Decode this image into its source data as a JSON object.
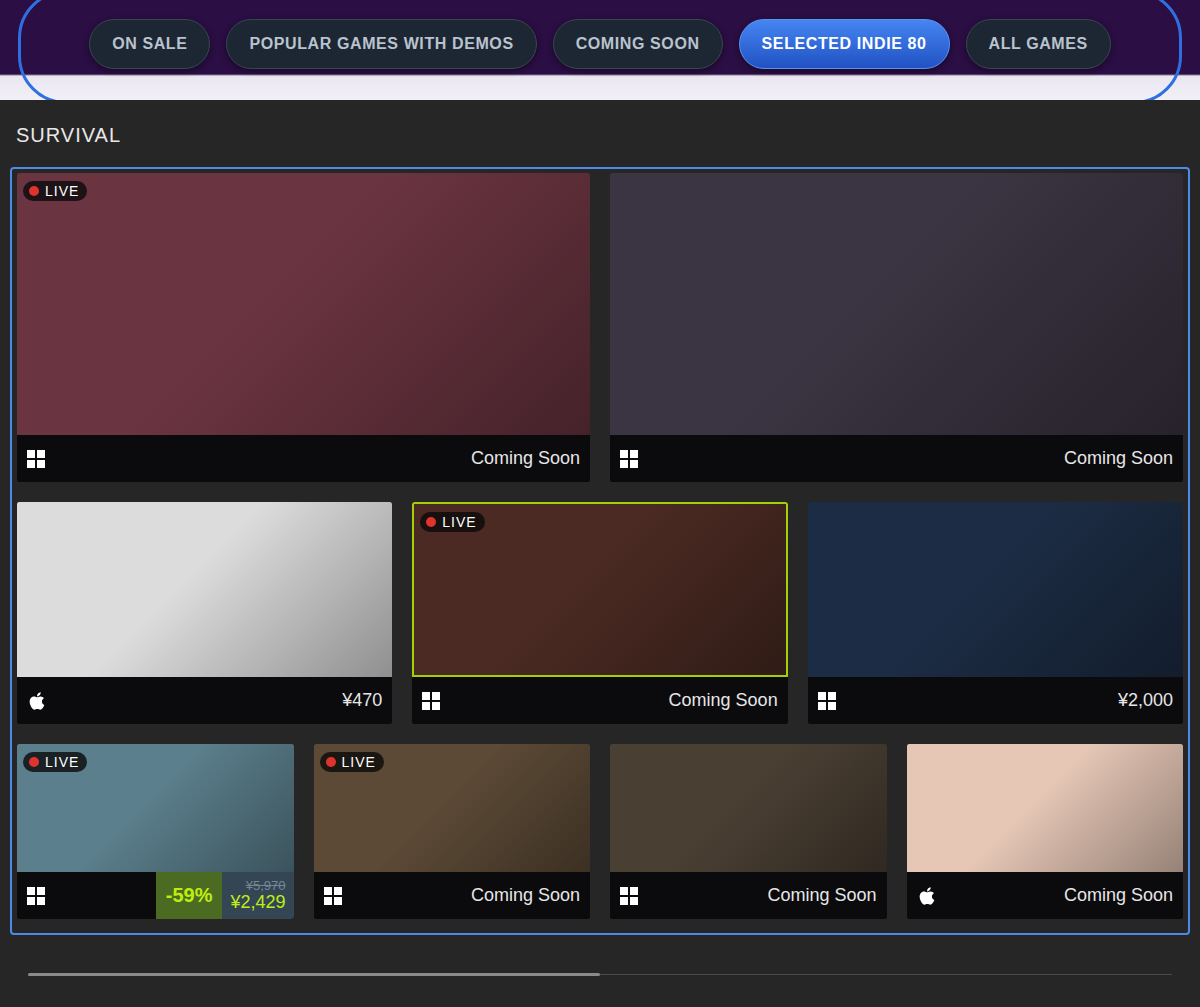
{
  "nav": {
    "tabs": [
      {
        "label": "ON SALE",
        "selected": false
      },
      {
        "label": "POPULAR GAMES WITH DEMOS",
        "selected": false
      },
      {
        "label": "COMING SOON",
        "selected": false
      },
      {
        "label": "SELECTED INDIE 80",
        "selected": true
      },
      {
        "label": "ALL GAMES",
        "selected": false
      }
    ]
  },
  "section": {
    "title": "SURVIVAL"
  },
  "live_badge": "LIVE",
  "rows": [
    {
      "games": [
        {
          "kind": "text",
          "platform": "windows",
          "price": "Coming Soon",
          "live": true,
          "highlighted": false,
          "color": "#6a3440"
        },
        {
          "kind": "text",
          "platform": "windows",
          "price": "Coming Soon",
          "live": false,
          "highlighted": false,
          "color": "#3b3442"
        }
      ]
    },
    {
      "games": [
        {
          "kind": "text",
          "platform": "apple",
          "price": "¥470",
          "live": false,
          "highlighted": false,
          "color": "#dcdcdc"
        },
        {
          "kind": "text",
          "platform": "windows",
          "price": "Coming Soon",
          "live": true,
          "highlighted": true,
          "color": "#4a2a22"
        },
        {
          "kind": "text",
          "platform": "windows",
          "price": "¥2,000",
          "live": false,
          "highlighted": false,
          "color": "#1c2c44"
        }
      ]
    },
    {
      "games": [
        {
          "kind": "discount",
          "platform": "windows",
          "discount": "-59%",
          "original_price": "¥5,970",
          "final_price": "¥2,429",
          "live": true,
          "highlighted": false,
          "color": "#5b7f8c"
        },
        {
          "kind": "text",
          "platform": "windows",
          "price": "Coming Soon",
          "live": true,
          "highlighted": false,
          "color": "#5c4a36"
        },
        {
          "kind": "text",
          "platform": "windows",
          "price": "Coming Soon",
          "live": false,
          "highlighted": false,
          "color": "#4a3f33"
        },
        {
          "kind": "text",
          "platform": "apple",
          "price": "Coming Soon",
          "live": false,
          "highlighted": false,
          "color": "#e6c7b6"
        }
      ]
    }
  ],
  "scrollbar": {
    "level": 0.5
  }
}
